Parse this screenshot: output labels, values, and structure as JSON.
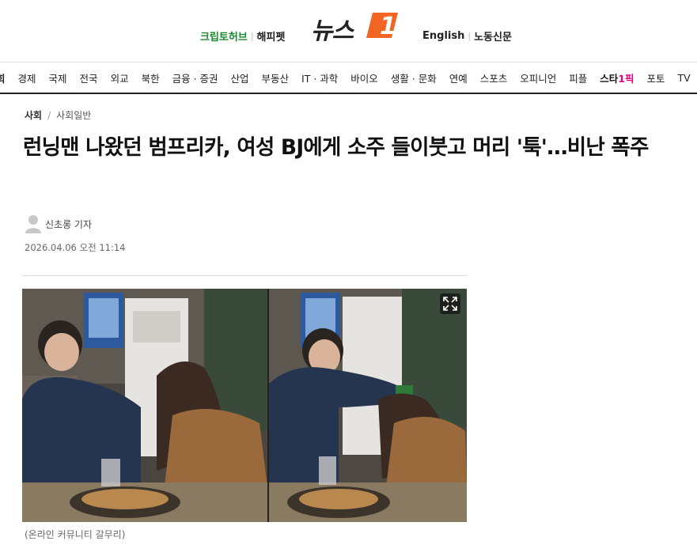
{
  "header": {
    "left_link_1": "크립토허브",
    "left_link_2": "해피펫",
    "logo_text": "뉴스",
    "logo_mark": "1",
    "right_link_1": "English",
    "right_link_2": "노동신문",
    "accent_green": "#1a8a2e",
    "accent_orange": "#f26522"
  },
  "nav": {
    "items": [
      "회",
      "경제",
      "국제",
      "전국",
      "외교",
      "북한",
      "금융 · 증권",
      "산업",
      "부동산",
      "IT · 과학",
      "바이오",
      "생활 · 문화",
      "연예",
      "스포츠",
      "오피니언",
      "피플",
      "스타1픽",
      "포토",
      "TV"
    ],
    "star_pick_prefix": "스타",
    "star_pick_suffix": "1픽",
    "star_pick_color": "#e6007e"
  },
  "article": {
    "breadcrumb_main": "사회",
    "breadcrumb_sep": "/",
    "breadcrumb_sub": "사회일반",
    "title": "런닝맨 나왔던 범프리카, 여성 BJ에게 소주 들이붓고 머리 '툭'…비난 폭주",
    "author": "신초롱 기자",
    "date": "2026.04.06 오전 11:14",
    "photo_caption": "(온라인 커뮤니티 갈무리)",
    "expand_icon": "expand-icon"
  }
}
